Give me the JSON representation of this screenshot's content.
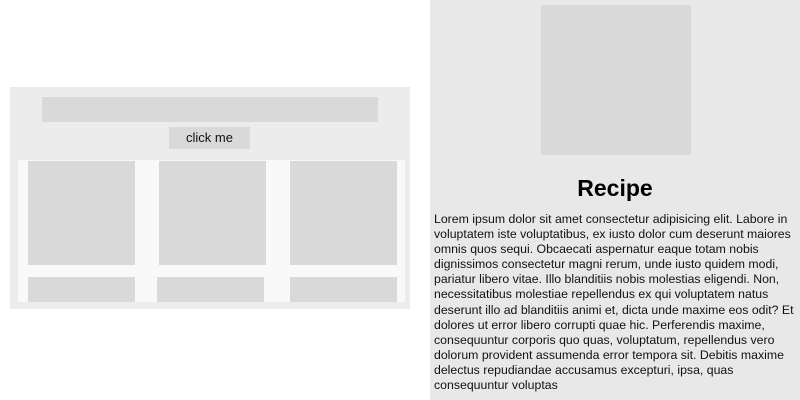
{
  "left_panel": {
    "button_label": "click me",
    "grid_rows": 2,
    "grid_columns": 3
  },
  "recipe": {
    "title": "Recipe",
    "body": "Lorem ipsum dolor sit amet consectetur adipisicing elit. Labore in voluptatem iste voluptatibus, ex iusto dolor cum deserunt maiores omnis quos sequi. Obcaecati aspernatur eaque totam nobis dignissimos consectetur magni rerum, unde iusto quidem modi, pariatur libero vitae. Illo blanditiis nobis molestias eligendi. Non, necessitatibus molestiae repellendus ex qui voluptatem natus deserunt illo ad blanditiis animi et, dicta unde maxime eos odit? Et dolores ut error libero corrupti quae hic. Perferendis maxime, consequuntur corporis quo quas, voluptatum, repellendus vero dolorum provident assumenda error tempora sit. Debitis maxime delectus repudiandae accusamus excepturi, ipsa, quas consequuntur voluptas"
  },
  "colors": {
    "panel_background": "#ececec",
    "placeholder": "#d9d9d9",
    "grid_background": "#f9f9f9",
    "right_background": "#e8e8e8"
  }
}
